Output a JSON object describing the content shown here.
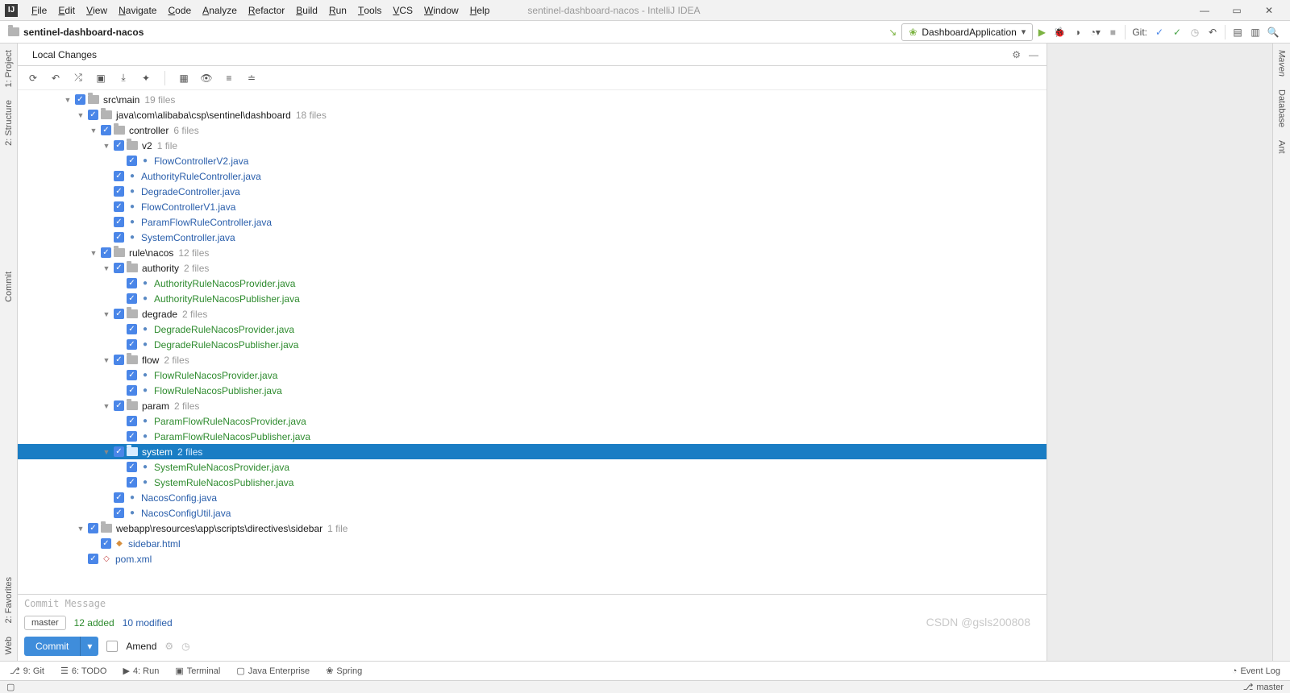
{
  "menu": {
    "items": [
      "File",
      "Edit",
      "View",
      "Navigate",
      "Code",
      "Analyze",
      "Refactor",
      "Build",
      "Run",
      "Tools",
      "VCS",
      "Window",
      "Help"
    ],
    "title_project": "sentinel-dashboard-nacos",
    "title_app": "IntelliJ IDEA"
  },
  "breadcrumb": {
    "project": "sentinel-dashboard-nacos"
  },
  "run_config": {
    "name": "DashboardApplication"
  },
  "git_label": "Git:",
  "left_tabs": {
    "project": "1: Project",
    "structure": "2: Structure",
    "commit": "Commit",
    "fav": "2: Favorites",
    "web": "Web"
  },
  "right_tabs": {
    "maven": "Maven",
    "database": "Database",
    "ant": "Ant"
  },
  "panel": {
    "title": "Local Changes"
  },
  "commit": {
    "placeholder": "Commit Message",
    "branch": "master",
    "added": "12 added",
    "modified": "10 modified",
    "button": "Commit",
    "amend": "Amend"
  },
  "bottombar": {
    "git": "9: Git",
    "todo": "6: TODO",
    "run": "4: Run",
    "terminal": "Terminal",
    "jee": "Java Enterprise",
    "spring": "Spring",
    "eventlog": "Event Log"
  },
  "statusbar": {
    "branch": "master"
  },
  "watermark": "CSDN @gsls200808",
  "tree": [
    {
      "d": 0,
      "t": "dir",
      "exp": true,
      "name": "src\\main",
      "count": "19 files"
    },
    {
      "d": 1,
      "t": "dir",
      "exp": true,
      "name": "java\\com\\alibaba\\csp\\sentinel\\dashboard",
      "count": "18 files"
    },
    {
      "d": 2,
      "t": "dir",
      "exp": true,
      "name": "controller",
      "count": "6 files"
    },
    {
      "d": 3,
      "t": "dir",
      "exp": true,
      "name": "v2",
      "count": "1 file"
    },
    {
      "d": 4,
      "t": "java",
      "cls": "modified",
      "name": "FlowControllerV2.java"
    },
    {
      "d": 3,
      "t": "java",
      "cls": "modified",
      "name": "AuthorityRuleController.java"
    },
    {
      "d": 3,
      "t": "java",
      "cls": "modified",
      "name": "DegradeController.java"
    },
    {
      "d": 3,
      "t": "java",
      "cls": "modified",
      "name": "FlowControllerV1.java"
    },
    {
      "d": 3,
      "t": "java",
      "cls": "modified",
      "name": "ParamFlowRuleController.java"
    },
    {
      "d": 3,
      "t": "java",
      "cls": "modified",
      "name": "SystemController.java"
    },
    {
      "d": 2,
      "t": "dir",
      "exp": true,
      "name": "rule\\nacos",
      "count": "12 files"
    },
    {
      "d": 3,
      "t": "dir",
      "exp": true,
      "name": "authority",
      "count": "2 files"
    },
    {
      "d": 4,
      "t": "java",
      "cls": "added",
      "name": "AuthorityRuleNacosProvider.java"
    },
    {
      "d": 4,
      "t": "java",
      "cls": "added",
      "name": "AuthorityRuleNacosPublisher.java"
    },
    {
      "d": 3,
      "t": "dir",
      "exp": true,
      "name": "degrade",
      "count": "2 files"
    },
    {
      "d": 4,
      "t": "java",
      "cls": "added",
      "name": "DegradeRuleNacosProvider.java"
    },
    {
      "d": 4,
      "t": "java",
      "cls": "added",
      "name": "DegradeRuleNacosPublisher.java"
    },
    {
      "d": 3,
      "t": "dir",
      "exp": true,
      "name": "flow",
      "count": "2 files"
    },
    {
      "d": 4,
      "t": "java",
      "cls": "added",
      "name": "FlowRuleNacosProvider.java"
    },
    {
      "d": 4,
      "t": "java",
      "cls": "added",
      "name": "FlowRuleNacosPublisher.java"
    },
    {
      "d": 3,
      "t": "dir",
      "exp": true,
      "name": "param",
      "count": "2 files"
    },
    {
      "d": 4,
      "t": "java",
      "cls": "added",
      "name": "ParamFlowRuleNacosProvider.java"
    },
    {
      "d": 4,
      "t": "java",
      "cls": "added",
      "name": "ParamFlowRuleNacosPublisher.java"
    },
    {
      "d": 3,
      "t": "dir",
      "exp": true,
      "sel": true,
      "name": "system",
      "count": "2 files"
    },
    {
      "d": 4,
      "t": "java",
      "cls": "added",
      "name": "SystemRuleNacosProvider.java"
    },
    {
      "d": 4,
      "t": "java",
      "cls": "added",
      "name": "SystemRuleNacosPublisher.java"
    },
    {
      "d": 3,
      "t": "java",
      "cls": "modified",
      "name": "NacosConfig.java"
    },
    {
      "d": 3,
      "t": "java",
      "cls": "modified",
      "name": "NacosConfigUtil.java"
    },
    {
      "d": 1,
      "t": "dir",
      "exp": true,
      "name": "webapp\\resources\\app\\scripts\\directives\\sidebar",
      "count": "1 file"
    },
    {
      "d": 2,
      "t": "html",
      "cls": "modified",
      "name": "sidebar.html"
    },
    {
      "d": 1,
      "t": "xml",
      "cls": "modified",
      "name": "pom.xml"
    }
  ]
}
